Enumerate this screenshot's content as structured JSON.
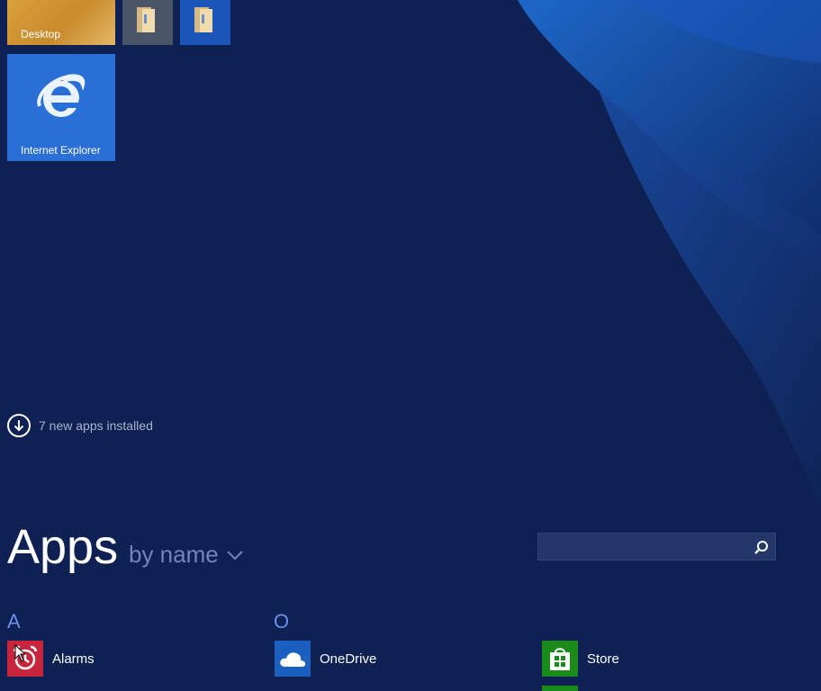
{
  "tiles": {
    "desktop_label": "Desktop",
    "ie_label": "Internet Explorer"
  },
  "notification": {
    "new_apps_text": "7 new apps installed"
  },
  "apps_view": {
    "title": "Apps",
    "sort_label": "by name"
  },
  "search": {
    "placeholder": ""
  },
  "groups": [
    {
      "letter": "A",
      "apps": [
        {
          "name": "Alarms",
          "icon": "alarm-icon"
        }
      ]
    },
    {
      "letter": "O",
      "apps": [
        {
          "name": "OneDrive",
          "icon": "cloud-icon"
        }
      ]
    },
    {
      "letter": "",
      "apps": [
        {
          "name": "Store",
          "icon": "store-bag-icon"
        }
      ]
    }
  ],
  "colors": {
    "background": "#0e2152",
    "accent_letter": "#6b8ef0",
    "alarms": "#c8243c",
    "onedrive": "#1b5fc0",
    "store": "#1a8a1a"
  }
}
